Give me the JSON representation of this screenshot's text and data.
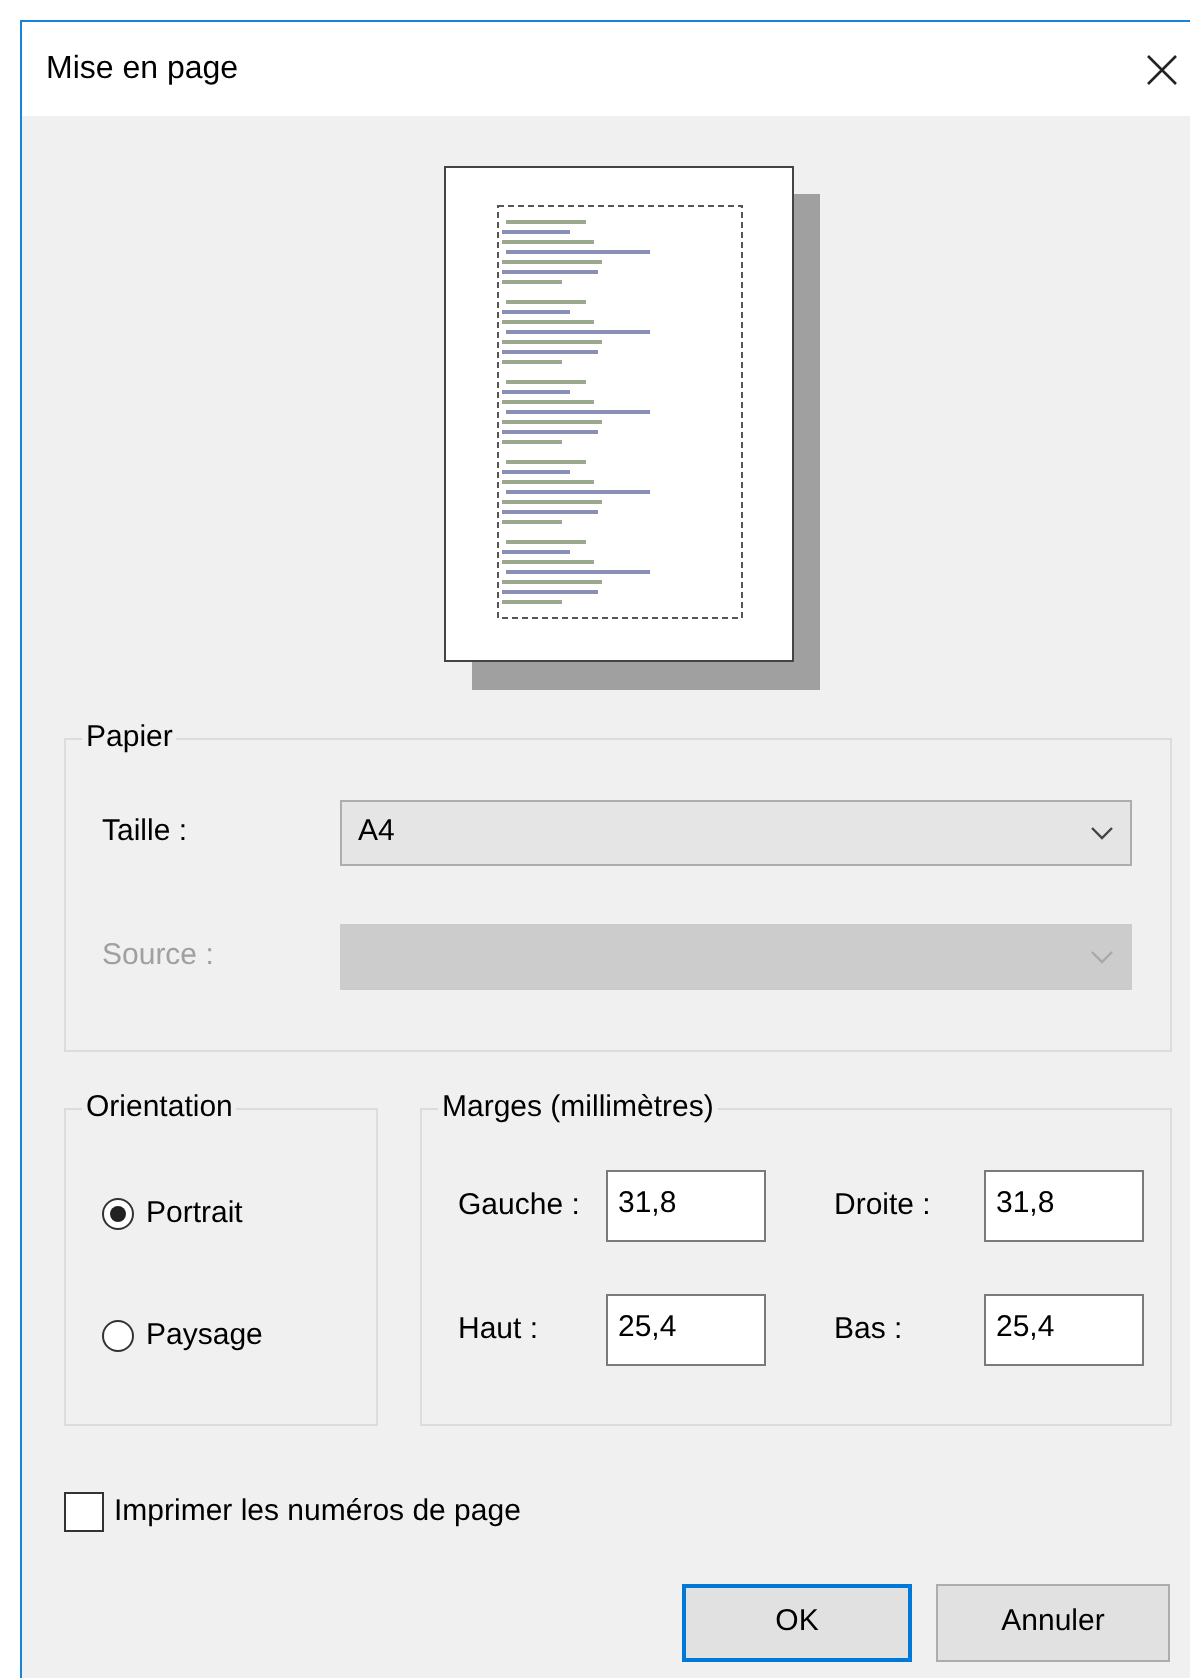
{
  "window": {
    "title": "Mise en page"
  },
  "paper": {
    "label": "Papier",
    "fields": [
      {
        "label": "Taille :",
        "value": "A4",
        "disabled": false
      },
      {
        "label": "Source :",
        "disabled": true
      }
    ]
  },
  "orientation": {
    "label": "Orientation",
    "options": [
      {
        "label": "Portrait",
        "selected": true
      },
      {
        "label": "Paysage",
        "selected": false
      }
    ]
  },
  "margins": {
    "label": "Marges (millimètres)",
    "fields": [
      {
        "label": "Gauche :",
        "value": "31,8"
      },
      {
        "label": "Droite :",
        "value": "31,8"
      },
      {
        "label": "Haut :",
        "value": "25,4"
      },
      {
        "label": "Bas :",
        "value": "25,4"
      }
    ]
  },
  "print_page_numbers": {
    "label": "Imprimer les numéros de page",
    "checked": false
  },
  "buttons": [
    {
      "label": "OK",
      "default": true
    },
    {
      "label": "Annuler",
      "default": false
    }
  ]
}
